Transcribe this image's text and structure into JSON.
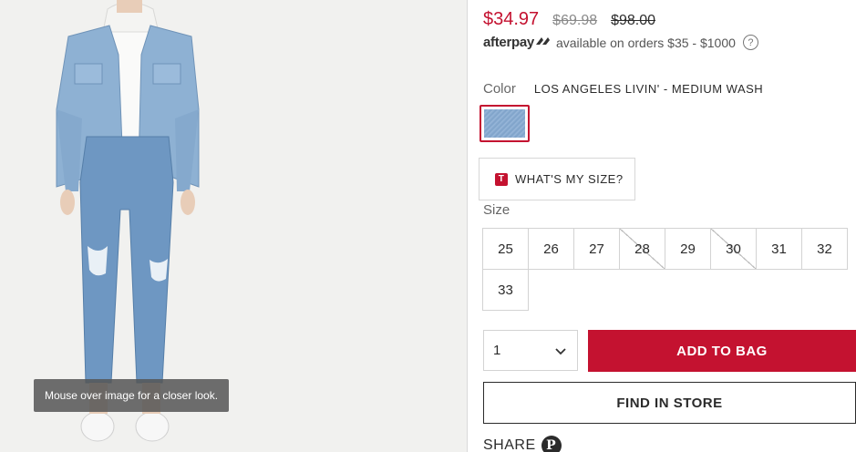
{
  "product": {
    "sale_price": "$34.97",
    "original_price": "$69.98",
    "list_price": "$98.00"
  },
  "afterpay": {
    "logo_text": "afterpay",
    "message": "available on orders $35 - $1000",
    "help_icon": "question-circle-icon"
  },
  "color": {
    "label": "Color",
    "value": "LOS ANGELES LIVIN' - MEDIUM WASH",
    "swatch_color": "#8fb0d4",
    "selected_border": "#c41230"
  },
  "size_guide": {
    "icon_letter": "T",
    "label": "WHAT'S MY SIZE?"
  },
  "size": {
    "label": "Size",
    "options": [
      {
        "value": "25",
        "available": true
      },
      {
        "value": "26",
        "available": true
      },
      {
        "value": "27",
        "available": true
      },
      {
        "value": "28",
        "available": false
      },
      {
        "value": "29",
        "available": true
      },
      {
        "value": "30",
        "available": false
      },
      {
        "value": "31",
        "available": true
      },
      {
        "value": "32",
        "available": true
      },
      {
        "value": "33",
        "available": true
      }
    ]
  },
  "quantity": {
    "value": "1"
  },
  "actions": {
    "add_to_bag": "ADD TO BAG",
    "find_in_store": "FIND IN STORE",
    "share": "SHARE"
  },
  "image": {
    "zoom_hint": "Mouse over image for a closer look."
  },
  "colors": {
    "accent": "#c41230",
    "text": "#2b2b2b",
    "muted": "#8a8a8a"
  }
}
